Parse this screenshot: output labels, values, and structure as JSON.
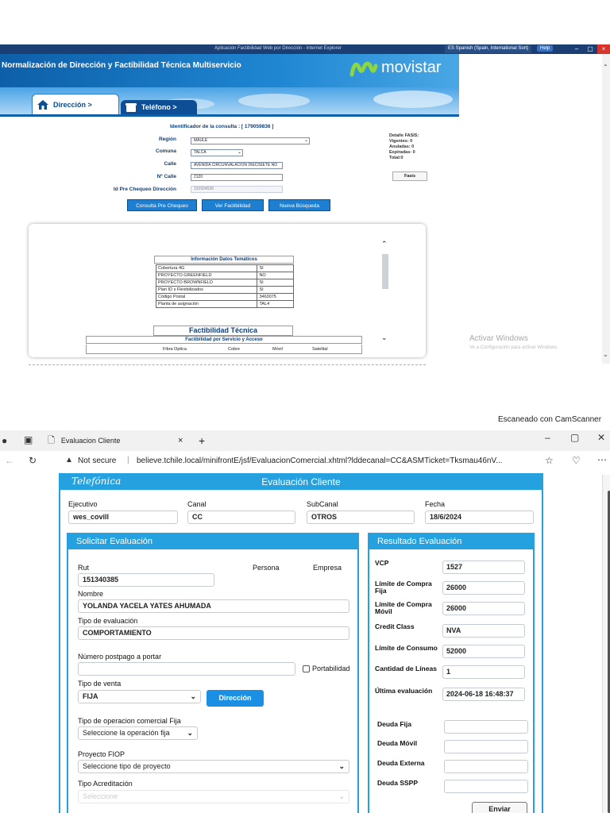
{
  "screen1": {
    "window_title": "Normalización de Dirección y Factibilidad Técnica Multiservicio",
    "ie_title": "Aplicación Factibilidad Web por Dirección - Internet Explorer",
    "language": "ES Spanish (Spain, International Sort)",
    "help_label": "Help",
    "app_title": "Normalización de Dirección y Factibilidad Técnica Multiservicio",
    "brand": "movistar",
    "tabs": [
      {
        "label": "Dirección >"
      },
      {
        "label": "Teléfono >"
      }
    ],
    "consulta_id": "Identificador de la consulta : [ 179059836 ]",
    "labels": {
      "region": "Región",
      "comuna": "Comuna",
      "calle": "Calle",
      "numero": "Nº Calle",
      "pre_chequeo": "Id Pre Chequeo Dirección"
    },
    "values": {
      "region": "MAULE",
      "comuna": "TALCA",
      "calle": "AVENIDA CIRCUNVALACION DIECISIETE NO",
      "numero": "2120",
      "pre_chequeo": "152924536"
    },
    "buttons": {
      "consulta": "Consulta Pre Chequeo",
      "ver": "Ver Factibilidad",
      "nueva": "Nueva Búsqueda"
    },
    "fasis": {
      "title": "Detalle FASIS:",
      "vigentes": "Vigentes: 0",
      "anuladas": "Anuladas: 0",
      "expiradas": "Expiradas: 0",
      "total": "Total:0",
      "button": "Fasis"
    },
    "tematicos_title": "Información Datos Temáticos",
    "tematicos": [
      {
        "k": "Cobertura 4G",
        "v": "SI"
      },
      {
        "k": "PROYECTO GREENFIELD",
        "v": "NO"
      },
      {
        "k": "PROYECTO BROWNFIELD",
        "v": "SI"
      },
      {
        "k": "Plan ID s Flexibilizados",
        "v": "SI"
      },
      {
        "k": "Código Postal",
        "v": "3463075"
      },
      {
        "k": "Planta de asignación",
        "v": "TAL4"
      }
    ],
    "factibilidad_title": "Factibilidad Técnica",
    "factibilidad_sub": "Factibilidad por Servicio y Acceso",
    "factibilidad_cols": [
      "Fibra Optica",
      "Cobre",
      "Móvil",
      "Satelital"
    ],
    "activar": "Activar Windows",
    "activar_sub": "Ve a Configuración para activar Windows."
  },
  "camscanner": "Escaneado con CamScanner",
  "browser": {
    "tab_title": "Evaluacion Cliente",
    "not_secure": "Not secure",
    "url": "believe.tchile.local/minifrontE/jsf/EvaluacionComercial.xhtml?lddecanal=CC&ASMTicket=Tksmau46nV...",
    "brand": "Telefónica",
    "page_title": "Evaluación Cliente",
    "top": {
      "ejecutivo_label": "Ejecutivo",
      "ejecutivo": "wes_covill",
      "canal_label": "Canal",
      "canal": "CC",
      "subcanal_label": "SubCanal",
      "subcanal": "OTROS",
      "fecha_label": "Fecha",
      "fecha": "18/6/2024"
    },
    "solicitar": {
      "title": "Solicitar Evaluación",
      "rut_label": "Rut",
      "rut": "151340385",
      "persona": "Persona",
      "empresa": "Empresa",
      "nombre_label": "Nombre",
      "nombre": "YOLANDA YACELA YATES AHUMADA",
      "tipo_eval_label": "Tipo de evaluación",
      "tipo_eval": "COMPORTAMIENTO",
      "postpago_label": "Número postpago a portar",
      "postpago": "",
      "portabilidad": "Portabilidad",
      "tipo_venta_label": "Tipo de venta",
      "tipo_venta": "FIJA",
      "direccion_btn": "Dirección",
      "tipo_op_label": "Tipo de operacion comercial Fija",
      "tipo_op": "Seleccione la operación fija",
      "proyecto_label": "Proyecto FIOP",
      "proyecto": "Seleccione tipo de proyecto",
      "acreditacion_label": "Tipo Acreditación",
      "acreditacion": "Seleccione"
    },
    "resultado": {
      "title": "Resultado Evaluación",
      "rows": [
        {
          "label": "VCP",
          "value": "1527"
        },
        {
          "label": "Límite de Compra Fija",
          "value": "26000"
        },
        {
          "label": "Límite de Compra Móvil",
          "value": "26000"
        },
        {
          "label": "Credit Class",
          "value": "NVA"
        },
        {
          "label": "Límite de Consumo",
          "value": "52000"
        },
        {
          "label": "Cantidad de Líneas",
          "value": "1"
        },
        {
          "label": "Última evaluación",
          "value": "2024-06-18 16:48:37"
        },
        {
          "label": "Deuda Fija",
          "value": ""
        },
        {
          "label": "Deuda Móvil",
          "value": ""
        },
        {
          "label": "Deuda Externa",
          "value": ""
        },
        {
          "label": "Deuda SSPP",
          "value": ""
        }
      ],
      "enviar": "Enviar"
    }
  }
}
